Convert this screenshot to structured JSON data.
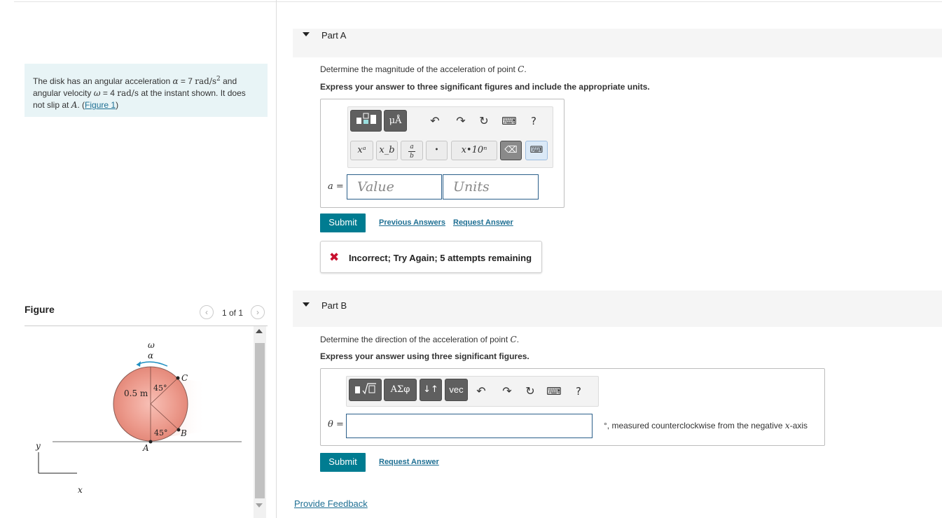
{
  "problem": {
    "text_1": "The disk has an angular acceleration ",
    "alpha_sym": "α",
    "alpha_val": " = 7 ",
    "alpha_unit": "rad/s",
    "alpha_exp": "2",
    "text_2": " and angular velocity ",
    "omega_sym": "ω",
    "omega_val": " = 4 ",
    "omega_unit": "rad/s",
    "text_3": " at the instant shown. It does not slip at ",
    "point": "A",
    "text_4": ". (",
    "figure_link": "Figure 1",
    "text_5": ")"
  },
  "figure": {
    "title": "Figure",
    "pager": "1 of 1",
    "prev_icon": "‹",
    "next_icon": "›",
    "labels": {
      "omega": "ω",
      "alpha": "α",
      "radius": "0.5 m",
      "angle_top": "45°",
      "angle_bottom": "45°",
      "C": "C",
      "B": "B",
      "A": "A",
      "y": "y",
      "x": "x"
    }
  },
  "partA": {
    "title": "Part A",
    "question_pre": "Determine the magnitude of the acceleration of point ",
    "question_point": "C",
    "question_post": ".",
    "instruction": "Express your answer to three significant figures and include the appropriate units.",
    "toolbar_row1": {
      "templates_icon": "templates-icon",
      "units_label": "μÅ",
      "undo": "↶",
      "redo": "↷",
      "reset": "↻",
      "keyboard": "⌨",
      "help": "?"
    },
    "toolbar_row2": {
      "superscript": "xᵃ",
      "subscript": "x_b",
      "fraction_top": "a",
      "fraction_bottom": "b",
      "dot": "•",
      "sci": "x•10ⁿ",
      "backspace": "⌫",
      "keyboard_toggle": "⌨"
    },
    "var_label": "a =",
    "value_placeholder": "Value",
    "units_placeholder": "Units",
    "submit": "Submit",
    "previous_answers": "Previous Answers",
    "request_answer": "Request Answer",
    "feedback": "Incorrect; Try Again; 5 attempts remaining",
    "feedback_icon": "✖"
  },
  "partB": {
    "title": "Part B",
    "question_pre": "Determine the direction of the acceleration of point ",
    "question_point": "C",
    "question_post": ".",
    "instruction": "Express your answer using three significant figures.",
    "toolbar": {
      "templates_icon": "templates-icon",
      "greek": "ΑΣφ",
      "arrows": "↓↑",
      "vec": "vec",
      "undo": "↶",
      "redo": "↷",
      "reset": "↻",
      "keyboard": "⌨",
      "help": "?"
    },
    "var_label": "θ =",
    "units_note_pre": "°, measured counterclockwise from the negative ",
    "units_note_axis": "x",
    "units_note_post": "-axis",
    "submit": "Submit",
    "request_answer": "Request Answer"
  },
  "provide_feedback": "Provide Feedback"
}
